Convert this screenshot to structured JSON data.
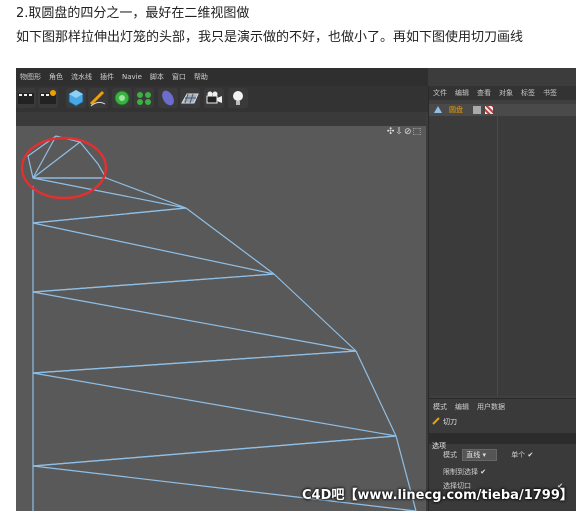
{
  "caption": {
    "line1": "2.取圆盘的四分之一，最好在二维视图做",
    "line2": "如下图那样拉伸出灯笼的头部，我只是演示做的不好，也做小了。再如下图使用切刀画线"
  },
  "menu": [
    "物图形",
    "角色",
    "流水线",
    "插件",
    "Navie",
    "脚本",
    "窗口",
    "帮助"
  ],
  "viewport_nav": "✣⇩⊘⬚",
  "object_manager": {
    "tabs": [
      "文件",
      "编辑",
      "查看",
      "对象",
      "标签",
      "书签"
    ],
    "object_name": "圆盘"
  },
  "attributes": {
    "tabs": [
      "模式",
      "编辑",
      "用户数据"
    ],
    "tool_title": "切刀",
    "section": "选项",
    "mode_label": "模式",
    "mode_value": "直线",
    "single_label": "单个",
    "restrict_label": "限制到选择",
    "visible_label": "选择切口",
    "checkmark": "✔"
  },
  "watermark": "C4D吧【www.linecg.com/tieba/1799】",
  "colors": {
    "wire": "#8fbfe6",
    "annotation_circle": "#e23030",
    "viewport_bg": "#595959",
    "object_name": "#f0a000"
  }
}
